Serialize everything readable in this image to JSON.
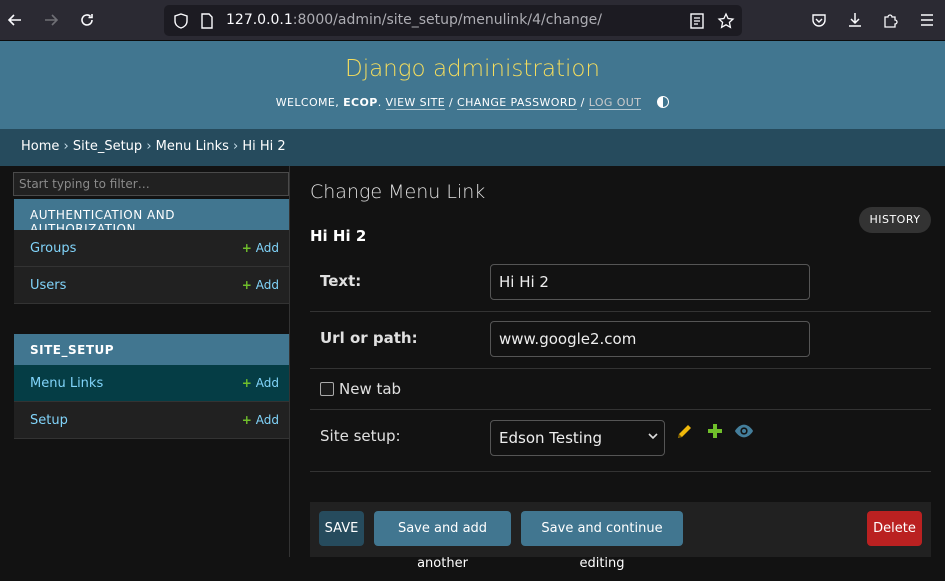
{
  "browser": {
    "url_host": "127.0.0.1",
    "url_rest": ":8000/admin/site_setup/menulink/4/change/"
  },
  "header": {
    "site_name": "Django administration",
    "welcome": "WELCOME,",
    "username": "ECOP",
    "view_site": "VIEW SITE",
    "change_password": "CHANGE PASSWORD",
    "log_out": "LOG OUT",
    "sep": "/"
  },
  "breadcrumbs": {
    "items": [
      "Home",
      "Site_Setup",
      "Menu Links",
      "Hi Hi 2"
    ],
    "sep": "›"
  },
  "sidebar": {
    "filter_placeholder": "Start typing to filter…",
    "add_label": "Add",
    "modules": [
      {
        "caption": "AUTHENTICATION AND AUTHORIZATION",
        "models": [
          {
            "name": "Groups"
          },
          {
            "name": "Users"
          }
        ]
      },
      {
        "caption": "SITE_SETUP",
        "models": [
          {
            "name": "Menu Links",
            "current": true
          },
          {
            "name": "Setup"
          }
        ]
      }
    ]
  },
  "content": {
    "title": "Change Menu Link",
    "history": "HISTORY",
    "object_title": "Hi Hi 2",
    "fields": {
      "text_label": "Text:",
      "text_value": "Hi Hi 2",
      "url_label": "Url or path:",
      "url_value": "www.google2.com",
      "new_tab_label": "New tab",
      "new_tab_checked": false,
      "site_setup_label": "Site setup:",
      "site_setup_value": "Edson Testing"
    },
    "buttons": {
      "save": "SAVE",
      "save_add": "Save and add another",
      "save_continue": "Save and continue editing",
      "delete": "Delete"
    }
  },
  "colors": {
    "header_bg": "#417690",
    "site_name": "#f5dd5d",
    "breadcrumbs_bg": "#264b5d",
    "link": "#81d4fa",
    "add_plus": "#70bf2b",
    "delete": "#ba2121"
  },
  "icons": {
    "back": "arrow-left-icon",
    "forward": "arrow-right-icon",
    "reload": "reload-icon",
    "shield": "shield-icon",
    "page": "page-icon",
    "reader": "reader-view-icon",
    "bookmark": "star-icon",
    "pocket": "pocket-icon",
    "downloads": "download-icon",
    "extensions": "puzzle-icon",
    "menu": "hamburger-menu-icon",
    "change": "pencil-icon",
    "add": "plus-icon",
    "view": "eye-icon"
  }
}
